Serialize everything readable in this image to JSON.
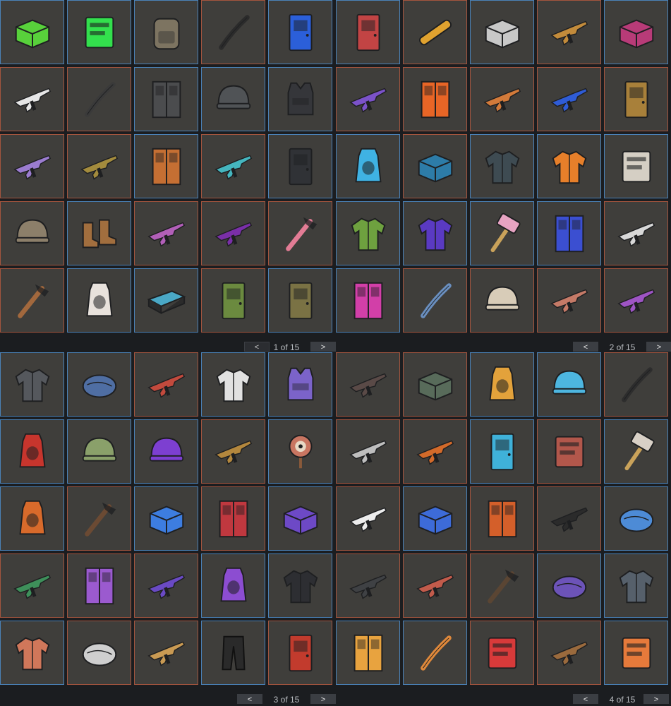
{
  "pages": [
    {
      "label": "1 of 15",
      "prev": "<",
      "next": ">"
    },
    {
      "label": "2 of 15",
      "prev": "<",
      "next": ">"
    },
    {
      "label": "3 of 15",
      "prev": "<",
      "next": ">"
    },
    {
      "label": "4 of 15",
      "prev": "<",
      "next": ">"
    }
  ],
  "colors": {
    "slot_bg": "#3f3e3b",
    "border_blue": "#4a82b8",
    "border_red": "#a4553e",
    "page_bg": "#1b1d20"
  },
  "grids": [
    [
      [
        {
          "name": "toxic-crate-icon",
          "c": "#58d13b",
          "k": "crate",
          "b": "b"
        },
        {
          "name": "neon-k-sign-icon",
          "c": "#33e04d",
          "k": "sign",
          "b": "b"
        },
        {
          "name": "backpack-icon",
          "c": "#7d7461",
          "k": "pack",
          "b": "b"
        },
        {
          "name": "bone-club-icon",
          "c": "#2b2b2b",
          "k": "stick",
          "b": "r"
        },
        {
          "name": "blue-door-icon",
          "c": "#2b5fd9",
          "k": "door",
          "b": "b"
        },
        {
          "name": "red-striped-door-icon",
          "c": "#c24444",
          "k": "door",
          "b": "b"
        },
        {
          "name": "rocket-launcher-icon",
          "c": "#e0a22f",
          "k": "tube",
          "b": "r"
        },
        {
          "name": "steel-crate-icon",
          "c": "#c8c8c8",
          "k": "crate",
          "b": "b"
        },
        {
          "name": "rifle-icon",
          "c": "#c28b3b",
          "k": "gun",
          "b": "r"
        },
        {
          "name": "pink-box-icon",
          "c": "#b83b78",
          "k": "crate",
          "b": "b"
        }
      ],
      [
        {
          "name": "white-thompson-icon",
          "c": "#e6e6e6",
          "k": "gun",
          "b": "r"
        },
        {
          "name": "bow-icon",
          "c": "#3a3a3a",
          "k": "stick",
          "b": "r"
        },
        {
          "name": "metal-locker-icon",
          "c": "#4b4c4e",
          "k": "locker",
          "b": "b"
        },
        {
          "name": "metal-helmet-icon",
          "c": "#505356",
          "k": "helmet",
          "b": "b"
        },
        {
          "name": "chest-plate-icon",
          "c": "#35363a",
          "k": "vest",
          "b": "b"
        },
        {
          "name": "purple-shotgun-icon",
          "c": "#7b52c9",
          "k": "gun",
          "b": "r"
        },
        {
          "name": "face-locker-icon",
          "c": "#e86526",
          "k": "locker",
          "b": "r"
        },
        {
          "name": "orange-shotgun-icon",
          "c": "#d27a3a",
          "k": "gun",
          "b": "r"
        },
        {
          "name": "blue-smg-icon",
          "c": "#2f5cd6",
          "k": "gun",
          "b": "r"
        },
        {
          "name": "gold-door-icon",
          "c": "#a8803a",
          "k": "door",
          "b": "r"
        }
      ],
      [
        {
          "name": "purple-rifle-icon",
          "c": "#9b7ccf",
          "k": "gun",
          "b": "r"
        },
        {
          "name": "gold-rifle-icon",
          "c": "#a38b3d",
          "k": "gun",
          "b": "r"
        },
        {
          "name": "painted-locker-icon",
          "c": "#c56f33",
          "k": "locker",
          "b": "b"
        },
        {
          "name": "teal-pistol-icon",
          "c": "#45b6bf",
          "k": "gun",
          "b": "r"
        },
        {
          "name": "flower-door-icon",
          "c": "#303236",
          "k": "door",
          "b": "b"
        },
        {
          "name": "blue-furnace-icon",
          "c": "#3fb2e3",
          "k": "furnace",
          "b": "b"
        },
        {
          "name": "blue-crate-icon",
          "c": "#2d7ca8",
          "k": "crate",
          "b": "r"
        },
        {
          "name": "black-hoodie-icon",
          "c": "#3e4b52",
          "k": "jacket",
          "b": "b"
        },
        {
          "name": "orange-jacket-icon",
          "c": "#e67f2a",
          "k": "jacket",
          "b": "b"
        },
        {
          "name": "wood-sign-icon",
          "c": "#d5cfc4",
          "k": "sign",
          "b": "b"
        }
      ],
      [
        {
          "name": "stone-helmet-icon",
          "c": "#8c7f6a",
          "k": "helmet",
          "b": "r"
        },
        {
          "name": "leather-boots-icon",
          "c": "#a16e3e",
          "k": "boots",
          "b": "b"
        },
        {
          "name": "pink-rifle-icon",
          "c": "#b25fb8",
          "k": "gun",
          "b": "r"
        },
        {
          "name": "mp5-icon",
          "c": "#7a2fa8",
          "k": "gun",
          "b": "r"
        },
        {
          "name": "pink-axe-icon",
          "c": "#e37c95",
          "k": "tool",
          "b": "r"
        },
        {
          "name": "green-jacket-icon",
          "c": "#6ea13f",
          "k": "jacket",
          "b": "b"
        },
        {
          "name": "purple-jacket-icon",
          "c": "#5a3ac2",
          "k": "jacket",
          "b": "b"
        },
        {
          "name": "pink-hammer-icon",
          "c": "#e7a3c2",
          "k": "hammer",
          "b": "b"
        },
        {
          "name": "vending-machine-icon",
          "c": "#3b4fd1",
          "k": "locker",
          "b": "b"
        },
        {
          "name": "white-smg-icon",
          "c": "#d8d8d8",
          "k": "gun",
          "b": "r"
        }
      ],
      [
        {
          "name": "pickaxe-icon",
          "c": "#a2683d",
          "k": "tool",
          "b": "r"
        },
        {
          "name": "snowman-furnace-icon",
          "c": "#e8e2dc",
          "k": "furnace",
          "b": "b"
        },
        {
          "name": "galaxy-bed-icon",
          "c": "#4aa8c6",
          "k": "bed",
          "b": "b"
        },
        {
          "name": "forest-door-icon",
          "c": "#6b8a3f",
          "k": "door",
          "b": "r"
        },
        {
          "name": "camo-door-icon",
          "c": "#7a7244",
          "k": "door",
          "b": "b"
        },
        {
          "name": "arcade-locker-icon",
          "c": "#d23fa8",
          "k": "locker",
          "b": "b"
        },
        {
          "name": "blue-knife-icon",
          "c": "#6a8fbf",
          "k": "stick",
          "b": "r"
        },
        {
          "name": "bucket-hat-icon",
          "c": "#d8ccb8",
          "k": "helmet",
          "b": "r"
        },
        {
          "name": "camo-rifle-icon",
          "c": "#c57a67",
          "k": "gun",
          "b": "r"
        },
        {
          "name": "purple-pistol-icon",
          "c": "#9e54c4",
          "k": "gun",
          "b": "r"
        }
      ]
    ],
    [
      [
        {
          "name": "dark-hoodie-icon",
          "c": "#55585d",
          "k": "jacket",
          "b": "b"
        },
        {
          "name": "blue-stone-icon",
          "c": "#4f6ea3",
          "k": "rock",
          "b": "b"
        },
        {
          "name": "red-rifle-icon",
          "c": "#c24a3d",
          "k": "gun",
          "b": "r"
        },
        {
          "name": "varsity-jacket-icon",
          "c": "#e1e1e1",
          "k": "jacket",
          "b": "b"
        },
        {
          "name": "hologram-vest-icon",
          "c": "#7b63c9",
          "k": "vest",
          "b": "b"
        },
        {
          "name": "dark-rifle-icon",
          "c": "#5a4a47",
          "k": "gun",
          "b": "r"
        },
        {
          "name": "dark-crate-icon",
          "c": "#586b5a",
          "k": "crate",
          "b": "r"
        },
        {
          "name": "gold-furnace-icon",
          "c": "#e3a23b",
          "k": "furnace",
          "b": "b"
        },
        {
          "name": "skull-mask-icon",
          "c": "#4db6e0",
          "k": "helmet",
          "b": "b"
        },
        {
          "name": "black-boomerang-icon",
          "c": "#2d2d2d",
          "k": "stick",
          "b": "r"
        }
      ],
      [
        {
          "name": "lava-furnace-icon",
          "c": "#c7352d",
          "k": "furnace",
          "b": "b"
        },
        {
          "name": "army-helmet-icon",
          "c": "#8aa06a",
          "k": "helmet",
          "b": "b"
        },
        {
          "name": "purple-beanie-icon",
          "c": "#7d3fd1",
          "k": "helmet",
          "b": "b"
        },
        {
          "name": "gold-pistol-icon",
          "c": "#b3873d",
          "k": "gun",
          "b": "r"
        },
        {
          "name": "target-icon",
          "c": "#c87561",
          "k": "target",
          "b": "b"
        },
        {
          "name": "white-shotgun-icon",
          "c": "#bebebe",
          "k": "gun",
          "b": "r"
        },
        {
          "name": "flame-rifle-icon",
          "c": "#d26a2a",
          "k": "gun",
          "b": "r"
        },
        {
          "name": "portal-door-icon",
          "c": "#3fb1d9",
          "k": "door",
          "b": "b"
        },
        {
          "name": "brick-door-icon",
          "c": "#b2574b",
          "k": "sign",
          "b": "r"
        },
        {
          "name": "wood-hammer-icon",
          "c": "#d8d0c6",
          "k": "hammer",
          "b": "b"
        }
      ],
      [
        {
          "name": "stone-furnace-icon",
          "c": "#d86a2b",
          "k": "furnace",
          "b": "b"
        },
        {
          "name": "wood-torch-icon",
          "c": "#6b4a33",
          "k": "tool",
          "b": "r"
        },
        {
          "name": "neon-crate-icon",
          "c": "#3d7de0",
          "k": "crate",
          "b": "b"
        },
        {
          "name": "smiley-locker-icon",
          "c": "#c0383f",
          "k": "locker",
          "b": "r"
        },
        {
          "name": "rivals-crate-icon",
          "c": "#6d49c6",
          "k": "crate",
          "b": "b"
        },
        {
          "name": "white-ak-icon",
          "c": "#ececec",
          "k": "gun",
          "b": "r"
        },
        {
          "name": "galaxy-crate-icon",
          "c": "#3d6bd8",
          "k": "crate",
          "b": "b"
        },
        {
          "name": "neon-locker-icon",
          "c": "#d45f2a",
          "k": "locker",
          "b": "r"
        },
        {
          "name": "sniper-icon",
          "c": "#2b2b2b",
          "k": "gun",
          "b": "r"
        },
        {
          "name": "earth-stone-icon",
          "c": "#4d8bd6",
          "k": "rock",
          "b": "b"
        }
      ],
      [
        {
          "name": "green-shotgun-icon",
          "c": "#3e8f5a",
          "k": "gun",
          "b": "r"
        },
        {
          "name": "purple-window-icon",
          "c": "#9b5acf",
          "k": "locker",
          "b": "r"
        },
        {
          "name": "violet-smg-icon",
          "c": "#6a4ac4",
          "k": "gun",
          "b": "r"
        },
        {
          "name": "purple-furnace-icon",
          "c": "#8c4dd1",
          "k": "furnace",
          "b": "b"
        },
        {
          "name": "black-jacket-icon",
          "c": "#2d2e32",
          "k": "jacket",
          "b": "b"
        },
        {
          "name": "revolver-icon",
          "c": "#3f4144",
          "k": "gun",
          "b": "r"
        },
        {
          "name": "red-ak-icon",
          "c": "#c25b4b",
          "k": "gun",
          "b": "r"
        },
        {
          "name": "dark-torch-icon",
          "c": "#5a4533",
          "k": "tool",
          "b": "r"
        },
        {
          "name": "purple-stone-icon",
          "c": "#6c53b8",
          "k": "rock",
          "b": "b"
        },
        {
          "name": "torn-shirt-icon",
          "c": "#56606b",
          "k": "jacket",
          "b": "b"
        }
      ],
      [
        {
          "name": "floral-jacket-icon",
          "c": "#d0775a",
          "k": "jacket",
          "b": "b"
        },
        {
          "name": "white-stone-icon",
          "c": "#cfcfcf",
          "k": "rock",
          "b": "r"
        },
        {
          "name": "tan-ak-icon",
          "c": "#c99a53",
          "k": "gun",
          "b": "r"
        },
        {
          "name": "black-pants-icon",
          "c": "#2a2a2a",
          "k": "pants",
          "b": "b"
        },
        {
          "name": "red-door-icon",
          "c": "#c23b2d",
          "k": "door",
          "b": "r"
        },
        {
          "name": "candy-barricade-icon",
          "c": "#e8a33f",
          "k": "locker",
          "b": "b"
        },
        {
          "name": "orange-boomerang-icon",
          "c": "#e0893b",
          "k": "stick",
          "b": "b"
        },
        {
          "name": "heartbeat-crate-icon",
          "c": "#d83a3a",
          "k": "sign",
          "b": "r"
        },
        {
          "name": "brown-rifle-icon",
          "c": "#9a6a3d",
          "k": "gun",
          "b": "r"
        },
        {
          "name": "orange-card-icon",
          "c": "#e67a3b",
          "k": "sign",
          "b": "b"
        }
      ]
    ]
  ]
}
